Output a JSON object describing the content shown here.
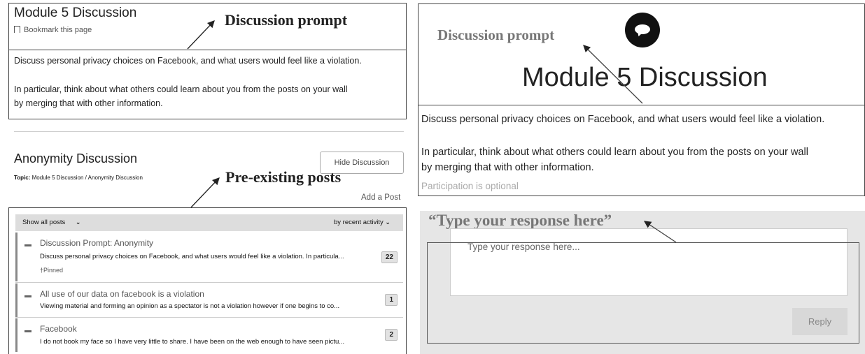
{
  "left": {
    "module_title": "Module 5 Discussion",
    "bookmark": "Bookmark this page",
    "prompt_line1": "Discuss personal privacy choices on Facebook, and what users would feel like a violation.",
    "prompt_line2": "In particular, think about what others could learn about you from the posts on your wall",
    "prompt_line3": "by merging that with other information.",
    "discussion_title": "Anonymity Discussion",
    "topic_label": "Topic:",
    "topic_value": "Module 5 Discussion / Anonymity Discussion",
    "hide_button": "Hide Discussion",
    "add_post": "Add a Post",
    "show_all": "Show all posts",
    "sort": "by recent activity",
    "posts": [
      {
        "title": "Discussion Prompt: Anonymity",
        "snippet": "Discuss personal privacy choices on Facebook, and what users would feel like a violation. In particula...",
        "count": "22",
        "pinned": "Pinned"
      },
      {
        "title": "All use of our data on facebook is a violation",
        "snippet": "Viewing material and forming an opinion as a spectator is not a violation however if one begins to co...",
        "count": "1"
      },
      {
        "title": "Facebook",
        "snippet": "I do not book my face so I have very little to share. I have been on the web enough to have seen pictu...",
        "count": "2"
      }
    ]
  },
  "right": {
    "module_title": "Module 5 Discussion",
    "prompt_line1": "Discuss personal privacy choices on Facebook, and what users would feel like a violation.",
    "prompt_line2": "In particular, think about what others could learn about you from the posts on your wall",
    "prompt_line3": "by merging that with other information.",
    "participation": "Participation is optional",
    "placeholder": "Type your response here...",
    "reply": "Reply"
  },
  "annotations": {
    "prompt_left": "Discussion prompt",
    "preexisting": "Pre-existing posts",
    "prompt_right": "Discussion prompt",
    "type_response": "“Type your response here”"
  }
}
